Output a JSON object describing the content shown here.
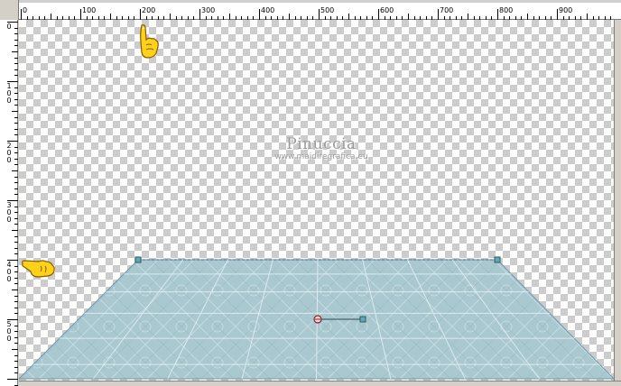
{
  "ruler": {
    "horizontal_labels": [
      "0",
      "100",
      "200",
      "300",
      "400",
      "500",
      "600",
      "700",
      "800",
      "900"
    ],
    "vertical_labels": [
      "0",
      "100",
      "200",
      "300",
      "400",
      "500"
    ]
  },
  "watermark": {
    "name": "Pinuccia",
    "site": "www.maidiregrafica.eu"
  },
  "canvas": {
    "transparency_checker": [
      "#ffffff",
      "#cccccc"
    ],
    "floor_color": "#a9c8d0",
    "floor_grid_color": "#e8f3f6",
    "handle_color": "#5fa8b4"
  },
  "icons": {
    "pointer_top": "hand-pointing-down-icon",
    "pointer_left": "hand-pointing-right-icon",
    "pivot": "rotation-pivot-icon",
    "rotation_handle": "rotation-handle-icon"
  }
}
